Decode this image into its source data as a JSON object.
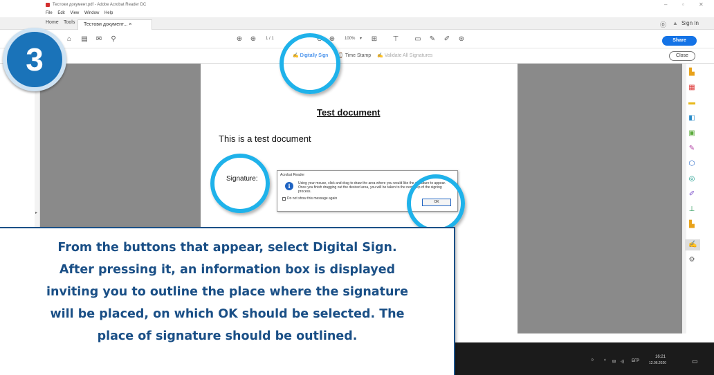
{
  "app": {
    "title": "Тестови документ.pdf - Adobe Acrobat Reader DC",
    "menu": [
      "File",
      "Edit",
      "View",
      "Window",
      "Help"
    ],
    "tabs": {
      "home": "Home",
      "tools": "Tools",
      "doc": "Тестови документ... ×"
    },
    "sign_in": "Sign In",
    "share": "Share",
    "close": "Close",
    "page_nav": "1 / 1",
    "zoom": "100%"
  },
  "sign_toolbar": {
    "digitally_sign": "Digitally Sign",
    "time_stamp": "Time Stamp",
    "validate_all": "Validate All Signatures"
  },
  "document": {
    "title": "Test document",
    "body": "This is a test document",
    "signature_label": "Signature:"
  },
  "dialog": {
    "title": "Acrobat Reader",
    "message": "Using your mouse, click and drag to draw the area where you would like the signature to appear. Once you finish dragging out the desired area, you will be taken to the next step of the signing process.",
    "checkbox": "Do not show this message again",
    "ok": "OK"
  },
  "step": {
    "number": "3"
  },
  "callout": {
    "line1": "From the buttons that appear, select Digital Sign.",
    "line2": "After pressing it, an information box is displayed",
    "line3": "inviting you to outline the place where the signature",
    "line4": "will be placed, on which OK should be selected. The",
    "line5": "place of signature should be outlined."
  },
  "taskbar": {
    "lang": "БГР",
    "time": "16:21",
    "date": "12.06.2020"
  },
  "colors": {
    "accent": "#1fb2ea",
    "callout": "#1a4f86",
    "badge": "#1a73b9",
    "share": "#1473e6"
  }
}
